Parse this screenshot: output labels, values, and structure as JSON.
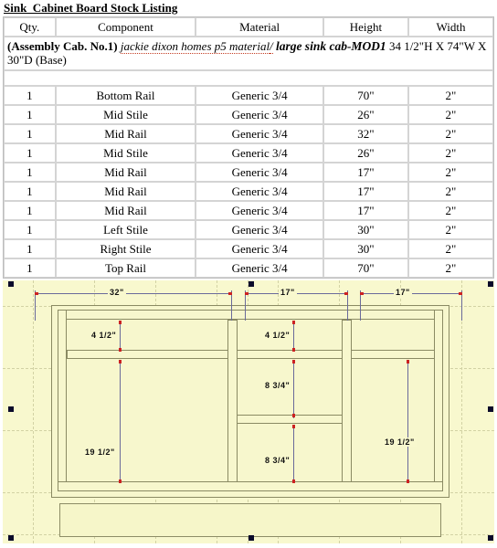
{
  "document": {
    "title": "Sink  Cabinet Board Stock Listing"
  },
  "table": {
    "headers": [
      "Qty.",
      "Component",
      "Material",
      "Height",
      "Width"
    ],
    "assembly": {
      "label": "(Assembly Cab. No.1)",
      "customer": "jackie dixon homes p5 material",
      "separator": "/",
      "model": "large sink cab-MOD1",
      "dimensions": "34 1/2\"H X 74\"W X 30\"D",
      "type": "(Base)"
    },
    "rows": [
      {
        "qty": "1",
        "component": "Bottom Rail",
        "material": "Generic 3/4",
        "height": "70\"",
        "width": "2\""
      },
      {
        "qty": "1",
        "component": "Mid Stile",
        "material": "Generic 3/4",
        "height": "26\"",
        "width": "2\""
      },
      {
        "qty": "1",
        "component": "Mid Rail",
        "material": "Generic 3/4",
        "height": "32\"",
        "width": "2\""
      },
      {
        "qty": "1",
        "component": "Mid Stile",
        "material": "Generic 3/4",
        "height": "26\"",
        "width": "2\""
      },
      {
        "qty": "1",
        "component": "Mid Rail",
        "material": "Generic 3/4",
        "height": "17\"",
        "width": "2\""
      },
      {
        "qty": "1",
        "component": "Mid Rail",
        "material": "Generic 3/4",
        "height": "17\"",
        "width": "2\""
      },
      {
        "qty": "1",
        "component": "Mid Rail",
        "material": "Generic 3/4",
        "height": "17\"",
        "width": "2\""
      },
      {
        "qty": "1",
        "component": "Left Stile",
        "material": "Generic 3/4",
        "height": "30\"",
        "width": "2\""
      },
      {
        "qty": "1",
        "component": "Right Stile",
        "material": "Generic 3/4",
        "height": "30\"",
        "width": "2\""
      },
      {
        "qty": "1",
        "component": "Top Rail",
        "material": "Generic 3/4",
        "height": "70\"",
        "width": "2\""
      }
    ]
  },
  "drawing": {
    "dimensions": {
      "top_left": "32\"",
      "top_middle": "17\"",
      "top_right": "17\"",
      "left_upper": "4  1/2\"",
      "middle_upper": "4  1/2\"",
      "middle_center": "8  3/4\"",
      "middle_lower": "8  3/4\"",
      "left_lower": "19  1/2\"",
      "right_lower": "19  1/2\""
    },
    "colors": {
      "canvas": "#f8f8ce",
      "grid": "#d2d2a4",
      "member_stroke": "#8a8a63",
      "dim_line": "#6a6a9a",
      "dim_endpoint": "#cc2222",
      "handle": "#0a0a2a"
    }
  }
}
